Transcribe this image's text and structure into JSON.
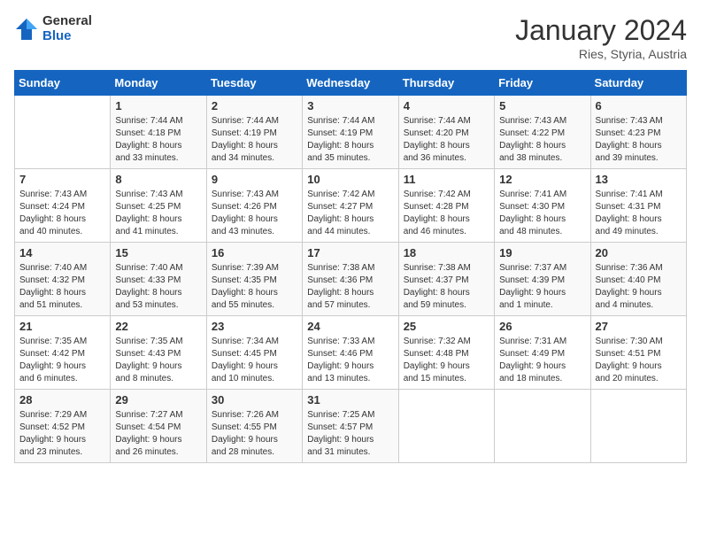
{
  "logo": {
    "general": "General",
    "blue": "Blue"
  },
  "header": {
    "title": "January 2024",
    "subtitle": "Ries, Styria, Austria"
  },
  "weekdays": [
    "Sunday",
    "Monday",
    "Tuesday",
    "Wednesday",
    "Thursday",
    "Friday",
    "Saturday"
  ],
  "weeks": [
    [
      {
        "day": "",
        "info": ""
      },
      {
        "day": "1",
        "info": "Sunrise: 7:44 AM\nSunset: 4:18 PM\nDaylight: 8 hours\nand 33 minutes."
      },
      {
        "day": "2",
        "info": "Sunrise: 7:44 AM\nSunset: 4:19 PM\nDaylight: 8 hours\nand 34 minutes."
      },
      {
        "day": "3",
        "info": "Sunrise: 7:44 AM\nSunset: 4:19 PM\nDaylight: 8 hours\nand 35 minutes."
      },
      {
        "day": "4",
        "info": "Sunrise: 7:44 AM\nSunset: 4:20 PM\nDaylight: 8 hours\nand 36 minutes."
      },
      {
        "day": "5",
        "info": "Sunrise: 7:43 AM\nSunset: 4:22 PM\nDaylight: 8 hours\nand 38 minutes."
      },
      {
        "day": "6",
        "info": "Sunrise: 7:43 AM\nSunset: 4:23 PM\nDaylight: 8 hours\nand 39 minutes."
      }
    ],
    [
      {
        "day": "7",
        "info": "Sunrise: 7:43 AM\nSunset: 4:24 PM\nDaylight: 8 hours\nand 40 minutes."
      },
      {
        "day": "8",
        "info": "Sunrise: 7:43 AM\nSunset: 4:25 PM\nDaylight: 8 hours\nand 41 minutes."
      },
      {
        "day": "9",
        "info": "Sunrise: 7:43 AM\nSunset: 4:26 PM\nDaylight: 8 hours\nand 43 minutes."
      },
      {
        "day": "10",
        "info": "Sunrise: 7:42 AM\nSunset: 4:27 PM\nDaylight: 8 hours\nand 44 minutes."
      },
      {
        "day": "11",
        "info": "Sunrise: 7:42 AM\nSunset: 4:28 PM\nDaylight: 8 hours\nand 46 minutes."
      },
      {
        "day": "12",
        "info": "Sunrise: 7:41 AM\nSunset: 4:30 PM\nDaylight: 8 hours\nand 48 minutes."
      },
      {
        "day": "13",
        "info": "Sunrise: 7:41 AM\nSunset: 4:31 PM\nDaylight: 8 hours\nand 49 minutes."
      }
    ],
    [
      {
        "day": "14",
        "info": "Sunrise: 7:40 AM\nSunset: 4:32 PM\nDaylight: 8 hours\nand 51 minutes."
      },
      {
        "day": "15",
        "info": "Sunrise: 7:40 AM\nSunset: 4:33 PM\nDaylight: 8 hours\nand 53 minutes."
      },
      {
        "day": "16",
        "info": "Sunrise: 7:39 AM\nSunset: 4:35 PM\nDaylight: 8 hours\nand 55 minutes."
      },
      {
        "day": "17",
        "info": "Sunrise: 7:38 AM\nSunset: 4:36 PM\nDaylight: 8 hours\nand 57 minutes."
      },
      {
        "day": "18",
        "info": "Sunrise: 7:38 AM\nSunset: 4:37 PM\nDaylight: 8 hours\nand 59 minutes."
      },
      {
        "day": "19",
        "info": "Sunrise: 7:37 AM\nSunset: 4:39 PM\nDaylight: 9 hours\nand 1 minute."
      },
      {
        "day": "20",
        "info": "Sunrise: 7:36 AM\nSunset: 4:40 PM\nDaylight: 9 hours\nand 4 minutes."
      }
    ],
    [
      {
        "day": "21",
        "info": "Sunrise: 7:35 AM\nSunset: 4:42 PM\nDaylight: 9 hours\nand 6 minutes."
      },
      {
        "day": "22",
        "info": "Sunrise: 7:35 AM\nSunset: 4:43 PM\nDaylight: 9 hours\nand 8 minutes."
      },
      {
        "day": "23",
        "info": "Sunrise: 7:34 AM\nSunset: 4:45 PM\nDaylight: 9 hours\nand 10 minutes."
      },
      {
        "day": "24",
        "info": "Sunrise: 7:33 AM\nSunset: 4:46 PM\nDaylight: 9 hours\nand 13 minutes."
      },
      {
        "day": "25",
        "info": "Sunrise: 7:32 AM\nSunset: 4:48 PM\nDaylight: 9 hours\nand 15 minutes."
      },
      {
        "day": "26",
        "info": "Sunrise: 7:31 AM\nSunset: 4:49 PM\nDaylight: 9 hours\nand 18 minutes."
      },
      {
        "day": "27",
        "info": "Sunrise: 7:30 AM\nSunset: 4:51 PM\nDaylight: 9 hours\nand 20 minutes."
      }
    ],
    [
      {
        "day": "28",
        "info": "Sunrise: 7:29 AM\nSunset: 4:52 PM\nDaylight: 9 hours\nand 23 minutes."
      },
      {
        "day": "29",
        "info": "Sunrise: 7:27 AM\nSunset: 4:54 PM\nDaylight: 9 hours\nand 26 minutes."
      },
      {
        "day": "30",
        "info": "Sunrise: 7:26 AM\nSunset: 4:55 PM\nDaylight: 9 hours\nand 28 minutes."
      },
      {
        "day": "31",
        "info": "Sunrise: 7:25 AM\nSunset: 4:57 PM\nDaylight: 9 hours\nand 31 minutes."
      },
      {
        "day": "",
        "info": ""
      },
      {
        "day": "",
        "info": ""
      },
      {
        "day": "",
        "info": ""
      }
    ]
  ]
}
